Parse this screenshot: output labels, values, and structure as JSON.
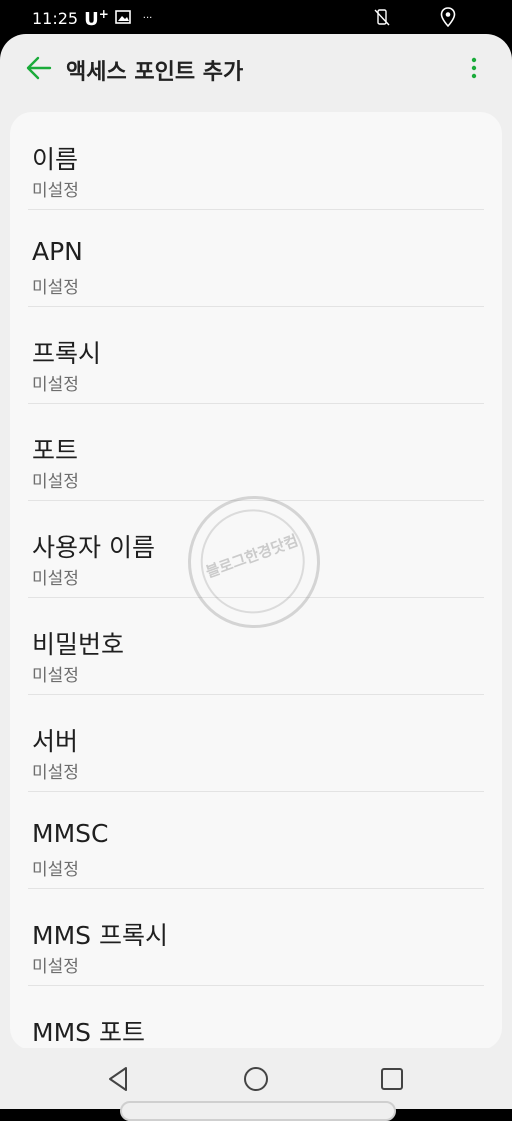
{
  "status_bar": {
    "time": "11:25",
    "carrier": "U",
    "carrier_sup": "+",
    "more": "···"
  },
  "app_bar": {
    "title": "액세스 포인트 추가",
    "accent_color": "#1aab3a"
  },
  "settings": [
    {
      "label": "이름",
      "value": "미설정"
    },
    {
      "label": "APN",
      "value": "미설정"
    },
    {
      "label": "프록시",
      "value": "미설정"
    },
    {
      "label": "포트",
      "value": "미설정"
    },
    {
      "label": "사용자 이름",
      "value": "미설정"
    },
    {
      "label": "비밀번호",
      "value": "미설정"
    },
    {
      "label": "서버",
      "value": "미설정"
    },
    {
      "label": "MMSC",
      "value": "미설정"
    },
    {
      "label": "MMS 프록시",
      "value": "미설정"
    },
    {
      "label": "MMS 포트",
      "value": ""
    }
  ],
  "watermark": {
    "text": "블로그한경닷컴"
  }
}
